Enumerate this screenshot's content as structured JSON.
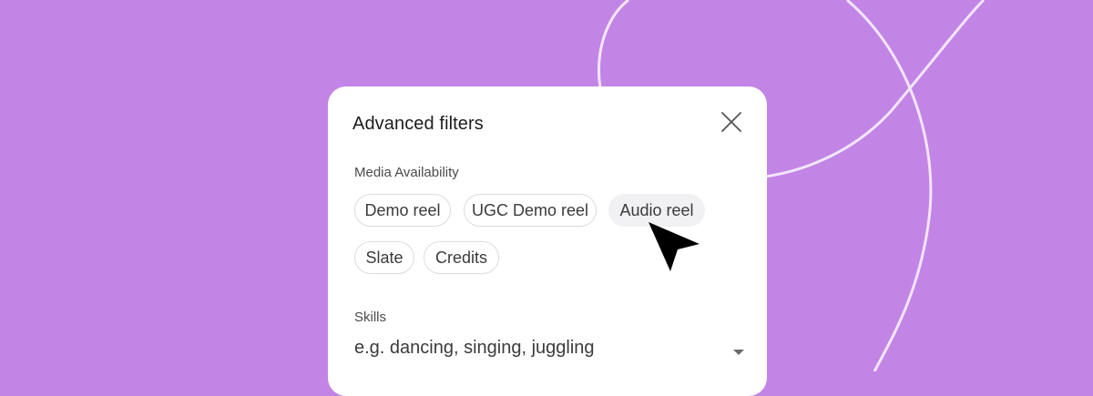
{
  "modal": {
    "title": "Advanced filters",
    "media_section": {
      "label": "Media Availability",
      "chips": [
        "Demo reel",
        "UGC Demo reel",
        "Audio reel",
        "Slate",
        "Credits"
      ],
      "hovered": "Audio reel"
    },
    "skills_section": {
      "label": "Skills",
      "placeholder": "e.g. dancing, singing, juggling"
    }
  },
  "icons": {
    "close": "close-icon",
    "dropdown": "chevron-down-icon",
    "cursor": "cursor-arrow-icon"
  },
  "colors": {
    "background": "#c285e6",
    "modal": "#ffffff",
    "chip_hover": "#f1f1f4",
    "text": "#1c1c1c"
  }
}
